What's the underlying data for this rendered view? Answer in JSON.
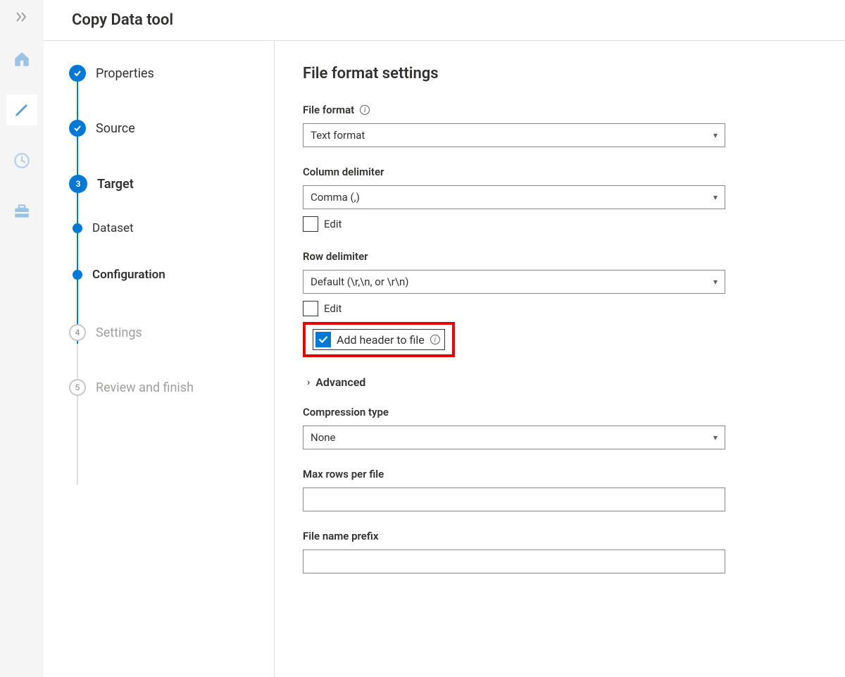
{
  "header": {
    "title": "Copy Data tool"
  },
  "rail": {
    "items": [
      {
        "name": "home-icon"
      },
      {
        "name": "edit-icon"
      },
      {
        "name": "monitor-icon"
      },
      {
        "name": "toolbox-icon"
      }
    ]
  },
  "wizard": {
    "steps": [
      {
        "label": "Properties",
        "state": "done"
      },
      {
        "label": "Source",
        "state": "done"
      },
      {
        "label": "Target",
        "state": "current",
        "number": "3",
        "sub": [
          {
            "label": "Dataset",
            "state": "done"
          },
          {
            "label": "Configuration",
            "state": "current"
          }
        ]
      },
      {
        "label": "Settings",
        "state": "pending",
        "number": "4"
      },
      {
        "label": "Review and finish",
        "state": "pending",
        "number": "5"
      }
    ]
  },
  "form": {
    "heading": "File format settings",
    "file_format": {
      "label": "File format",
      "value": "Text format"
    },
    "col_delim": {
      "label": "Column delimiter",
      "value": "Comma (,)",
      "edit": "Edit"
    },
    "row_delim": {
      "label": "Row delimiter",
      "value": "Default (\\r,\\n, or \\r\\n)",
      "edit": "Edit"
    },
    "add_header": {
      "label": "Add header to file",
      "checked": true
    },
    "advanced": {
      "label": "Advanced"
    },
    "compression": {
      "label": "Compression type",
      "value": "None"
    },
    "max_rows": {
      "label": "Max rows per file",
      "value": ""
    },
    "prefix": {
      "label": "File name prefix",
      "value": ""
    }
  }
}
